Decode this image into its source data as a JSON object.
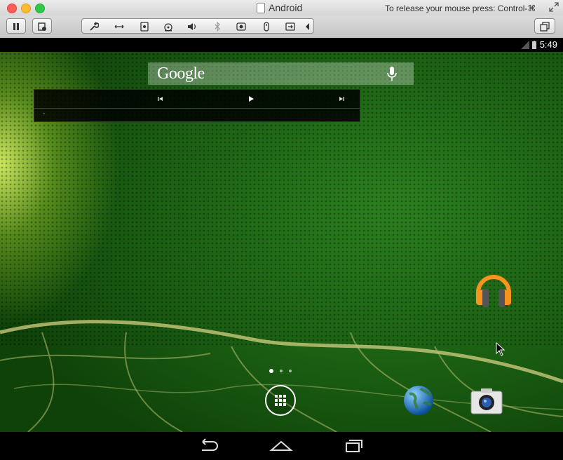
{
  "window": {
    "title": "Android",
    "release_hint": "To release your mouse press: Control-⌘"
  },
  "toolbar": {
    "buttons": [
      "pause-icon",
      "snapshot-icon",
      "settings-wrench-icon",
      "network-icon",
      "hard-disk-icon",
      "cd-dvd-icon",
      "sound-icon",
      "bluetooth-icon",
      "camera-device-icon",
      "usb-icon",
      "sharing-icon",
      "collapse-arrow-icon",
      "fullscreen-icon"
    ]
  },
  "status_bar": {
    "time": "5:49"
  },
  "search": {
    "logo": "Google"
  },
  "music_widget": {
    "track": "-"
  },
  "home": {
    "pager_pages": 3,
    "current_page": 1
  },
  "colors": {
    "wallpaper_green": "#1a5d12",
    "widget_bg": "#000000",
    "status_bar_bg": "#000000"
  }
}
